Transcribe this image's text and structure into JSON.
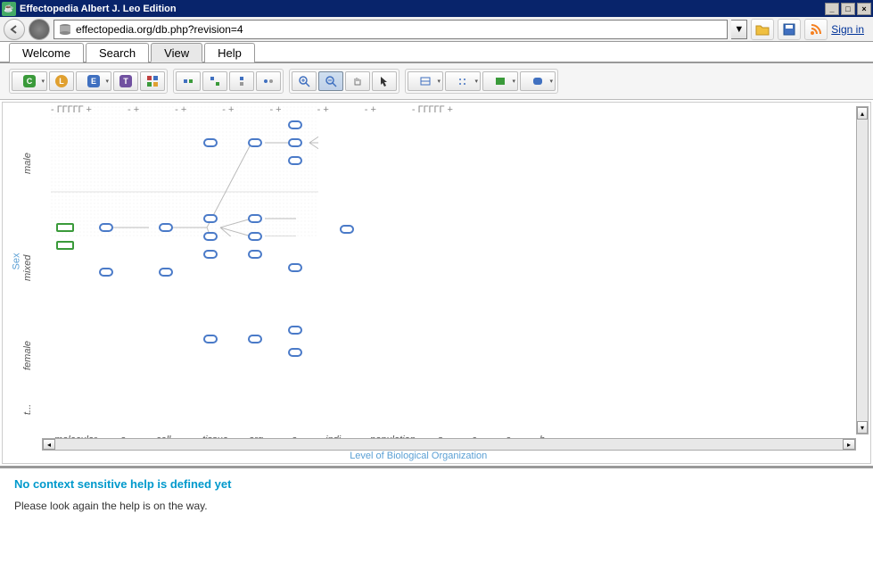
{
  "window": {
    "title": "Effectopedia  Albert J. Leo Edition"
  },
  "nav": {
    "url": "effectopedia.org/db.php?revision=4",
    "signin": "Sign in"
  },
  "tabs": {
    "items": [
      "Welcome",
      "Search",
      "View",
      "Help"
    ],
    "active": 2
  },
  "toolbar": {
    "c": "C",
    "l": "L",
    "e": "E",
    "t": "T"
  },
  "axes": {
    "y_title": "Sex",
    "y_labels": [
      "male",
      "mixed",
      "female",
      "t..."
    ],
    "x_title": "Level of Biological Organization",
    "x_labels": [
      "molecular",
      "-",
      "o...",
      "-",
      "cell...",
      "-",
      "tissue",
      "-",
      "org...",
      "-",
      "o...",
      "-",
      "indi...",
      "-",
      "population",
      "-",
      "s...",
      "-",
      "c...",
      "-",
      "e...",
      "-",
      "b..."
    ],
    "top_ticks": [
      "-  ГГГГГ +",
      "-  +",
      "-  +",
      "-  +",
      "-  +",
      "-  +",
      "-  +",
      "-  ГГГГГ +"
    ]
  },
  "help": {
    "title": "No context sensitive help is defined yet",
    "body": "Please look again the help is on the way."
  },
  "chart_data": {
    "type": "diagram",
    "rows": [
      "male",
      "mixed",
      "female"
    ],
    "columns": [
      "molecular",
      "o",
      "cell",
      "tissue",
      "org",
      "o",
      "indi",
      "population",
      "s",
      "c",
      "e",
      "b"
    ],
    "nodes": [
      {
        "row": "male",
        "col": 4,
        "y": 0
      },
      {
        "row": "male",
        "col": 5,
        "y": 0
      },
      {
        "row": "male",
        "col": 6,
        "y": -1
      },
      {
        "row": "male",
        "col": 6,
        "y": 0
      },
      {
        "row": "male",
        "col": 6,
        "y": 1
      },
      {
        "row": "mixed",
        "col": 0,
        "y": -0.5,
        "type": "green"
      },
      {
        "row": "mixed",
        "col": 0,
        "y": 0.5,
        "type": "green"
      },
      {
        "row": "mixed",
        "col": 1,
        "y": -0.5
      },
      {
        "row": "mixed",
        "col": 1,
        "y": 1
      },
      {
        "row": "mixed",
        "col": 3,
        "y": -0.5
      },
      {
        "row": "mixed",
        "col": 3,
        "y": 1
      },
      {
        "row": "mixed",
        "col": 4,
        "y": -1
      },
      {
        "row": "mixed",
        "col": 4,
        "y": 0
      },
      {
        "row": "mixed",
        "col": 4,
        "y": 1
      },
      {
        "row": "mixed",
        "col": 5,
        "y": -1
      },
      {
        "row": "mixed",
        "col": 5,
        "y": 0
      },
      {
        "row": "mixed",
        "col": 5,
        "y": 1
      },
      {
        "row": "mixed",
        "col": 6,
        "y": 1
      },
      {
        "row": "mixed",
        "col": 7,
        "y": -0.5
      },
      {
        "row": "female",
        "col": 4,
        "y": 0
      },
      {
        "row": "female",
        "col": 5,
        "y": 0
      },
      {
        "row": "female",
        "col": 6,
        "y": -0.5
      },
      {
        "row": "female",
        "col": 6,
        "y": 0.5
      }
    ]
  }
}
